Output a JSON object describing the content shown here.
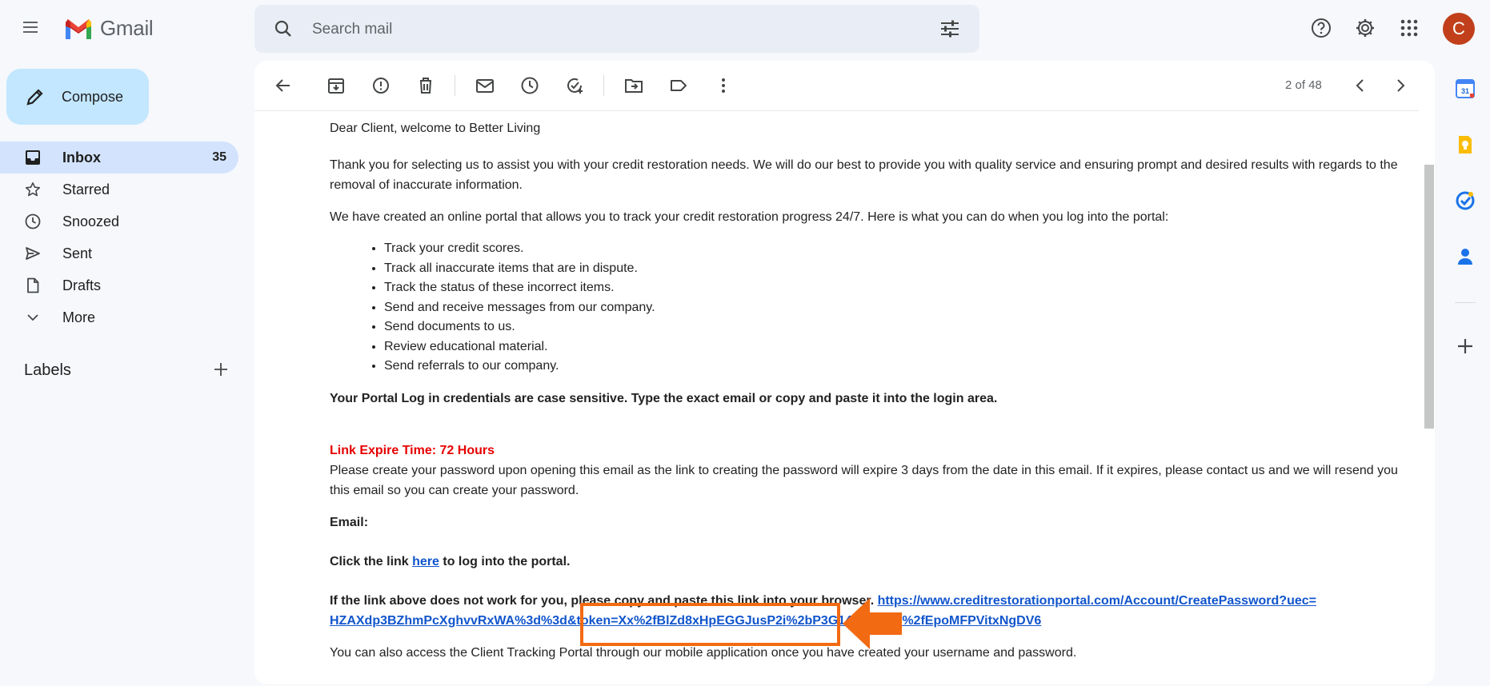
{
  "app": {
    "logo_text": "Gmail"
  },
  "search": {
    "placeholder": "Search mail"
  },
  "user": {
    "avatar_letter": "C",
    "avatar_color": "#c1401b"
  },
  "sidebar": {
    "compose_label": "Compose",
    "items": [
      {
        "label": "Inbox",
        "count": "35",
        "icon": "inbox-icon",
        "active": true
      },
      {
        "label": "Starred",
        "count": "",
        "icon": "star-icon"
      },
      {
        "label": "Snoozed",
        "count": "",
        "icon": "clock-icon"
      },
      {
        "label": "Sent",
        "count": "",
        "icon": "send-icon"
      },
      {
        "label": "Drafts",
        "count": "",
        "icon": "draft-icon"
      },
      {
        "label": "More",
        "count": "",
        "icon": "chevron-down-icon"
      }
    ],
    "labels_heading": "Labels"
  },
  "toolbar": {
    "pager": "2 of 48"
  },
  "email": {
    "greeting": "Dear Client, welcome to Better Living",
    "intro": "Thank you for selecting us to assist you with your credit restoration needs. We will do our best to provide you with quality service and ensuring prompt and desired results with regards to the removal of inaccurate information.",
    "portal_intro": "We have created an online portal that allows you to track your credit restoration progress 24/7. Here is what you can do when you log into the portal:",
    "features": [
      "Track your credit scores.",
      "Track all inaccurate items that are in dispute.",
      "Track the status of these incorrect items.",
      "Send and receive messages from our company.",
      "Send documents to us.",
      "Review educational material.",
      "Send referrals to our company."
    ],
    "credentials_note": "Your Portal Log in credentials are case sensitive. Type the exact email or copy and paste it into the login area.",
    "expire_title": "Link Expire Time: 72 Hours",
    "expire_text": "Please create your password upon opening this email as the link to creating the password will expire 3 days from the date in this email. If it expires, please contact us and we will resend you this email so you can create your password.",
    "email_label": "Email:",
    "click_prefix": "Click the link ",
    "click_link": "here",
    "click_suffix": " to log into the portal.",
    "copy_note": "If the link above does not work for you, please copy and paste this link into your browser. ",
    "url_line1": "https://www.creditrestorationportal.com/Account/CreatePassword?uec=",
    "url_line2": "HZAXdp3BZhmPcXghvvRxWA%3d%3d&token=Xx%2fBlZd8xHpEGGJusP2i%2bP3G14YY2mae%2fEpoMFPVitxNgDV6",
    "mobile_note": "You can also access the Client Tracking Portal through our mobile application once you have created your username and password."
  },
  "colors": {
    "highlight": "#f26a12",
    "accent": "#c2e7ff",
    "active_nav": "#d3e3fd"
  }
}
